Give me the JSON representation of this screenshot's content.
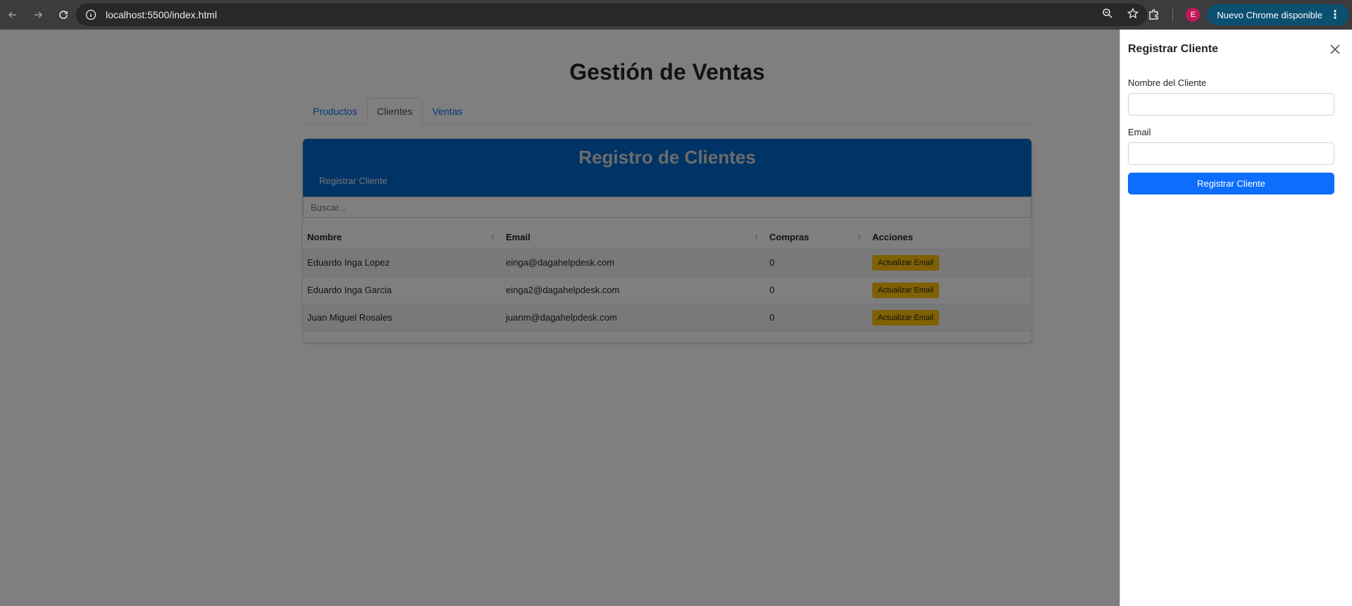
{
  "browser": {
    "url": "localhost:5500/index.html",
    "profile_initial": "E",
    "update_label": "Nuevo Chrome disponible"
  },
  "page": {
    "title": "Gestión de Ventas",
    "tabs": [
      {
        "label": "Productos"
      },
      {
        "label": "Clientes"
      },
      {
        "label": "Ventas"
      }
    ],
    "active_tab": "Clientes",
    "card": {
      "title": "Registro de Clientes",
      "register_button": "Registrar Cliente",
      "search_placeholder": "Buscar...",
      "columns": [
        "Nombre",
        "Email",
        "Compras",
        "Acciones"
      ],
      "rows": [
        {
          "nombre": "Eduardo Inga Lopez",
          "email": "einga@dagahelpdesk.com",
          "compras": "0",
          "accion": "Actualizar Email"
        },
        {
          "nombre": "Eduardo Inga Garcia",
          "email": "einga2@dagahelpdesk.com",
          "compras": "0",
          "accion": "Actualizar Email"
        },
        {
          "nombre": "Juan Miguel Rosales",
          "email": "juanm@dagahelpdesk.com",
          "compras": "0",
          "accion": "Actualizar Email"
        }
      ]
    }
  },
  "offcanvas": {
    "title": "Registrar Cliente",
    "name_label": "Nombre del Cliente",
    "name_value": "",
    "email_label": "Email",
    "email_value": "",
    "submit_label": "Registrar Cliente"
  },
  "colors": {
    "card_header": "#0066cc",
    "primary": "#0d6efd",
    "warning": "#ffc107"
  }
}
